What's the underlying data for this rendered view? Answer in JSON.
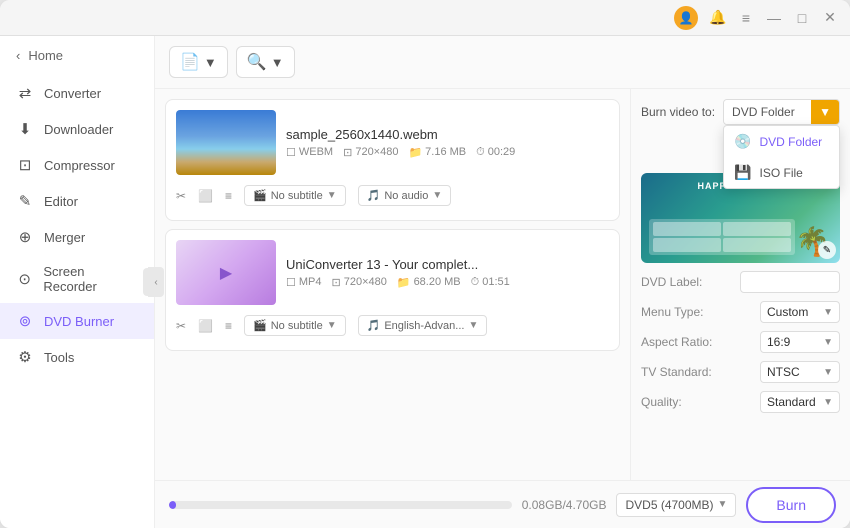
{
  "titlebar": {
    "icons": [
      "≡",
      "—",
      "□",
      "✕"
    ],
    "avatar_label": "U"
  },
  "sidebar": {
    "home_label": "Home",
    "back_icon": "‹",
    "items": [
      {
        "id": "converter",
        "label": "Converter",
        "icon": "⇄"
      },
      {
        "id": "downloader",
        "label": "Downloader",
        "icon": "↓"
      },
      {
        "id": "compressor",
        "label": "Compressor",
        "icon": "⊡"
      },
      {
        "id": "editor",
        "label": "Editor",
        "icon": "✎"
      },
      {
        "id": "merger",
        "label": "Merger",
        "icon": "⊕"
      },
      {
        "id": "screen-recorder",
        "label": "Screen Recorder",
        "icon": "⊙"
      },
      {
        "id": "dvd-burner",
        "label": "DVD Burner",
        "icon": "⊚",
        "active": true
      },
      {
        "id": "tools",
        "label": "Tools",
        "icon": "⚙"
      }
    ]
  },
  "toolbar": {
    "add_file_label": "▼",
    "add_file_icon": "📄",
    "add_folder_icon": "🔍",
    "add_folder_label": "▼"
  },
  "burn_to": {
    "label": "Burn video to:",
    "current_value": "DVD Folder",
    "options": [
      {
        "id": "dvd-folder",
        "label": "DVD Folder",
        "icon": "💿"
      },
      {
        "id": "iso-file",
        "label": "ISO File",
        "icon": "💽"
      }
    ]
  },
  "files": [
    {
      "id": "file1",
      "name": "sample_2560x1440.webm",
      "format": "WEBM",
      "resolution": "720×480",
      "size": "7.16 MB",
      "duration": "00:29",
      "subtitle": "No subtitle",
      "audio": "No audio",
      "thumb_type": "beach"
    },
    {
      "id": "file2",
      "name": "UniConverter 13 - Your complet...",
      "format": "MP4",
      "resolution": "720×480",
      "size": "68.20 MB",
      "duration": "01:51",
      "subtitle": "No subtitle",
      "audio": "English-Advan...",
      "thumb_type": "purple"
    }
  ],
  "settings": {
    "dvd_label": "DVD Label:",
    "dvd_label_value": "",
    "menu_type_label": "Menu Type:",
    "menu_type_value": "Custom",
    "aspect_ratio_label": "Aspect Ratio:",
    "aspect_ratio_value": "16:9",
    "tv_standard_label": "TV Standard:",
    "tv_standard_value": "NTSC",
    "quality_label": "Quality:",
    "quality_value": "Standard"
  },
  "bottom": {
    "progress_text": "0.08GB/4.70GB",
    "disk_type": "DVD5 (4700MB)",
    "burn_label": "Burn"
  },
  "colors": {
    "accent": "#7b5ef8",
    "orange": "#f0a500"
  }
}
